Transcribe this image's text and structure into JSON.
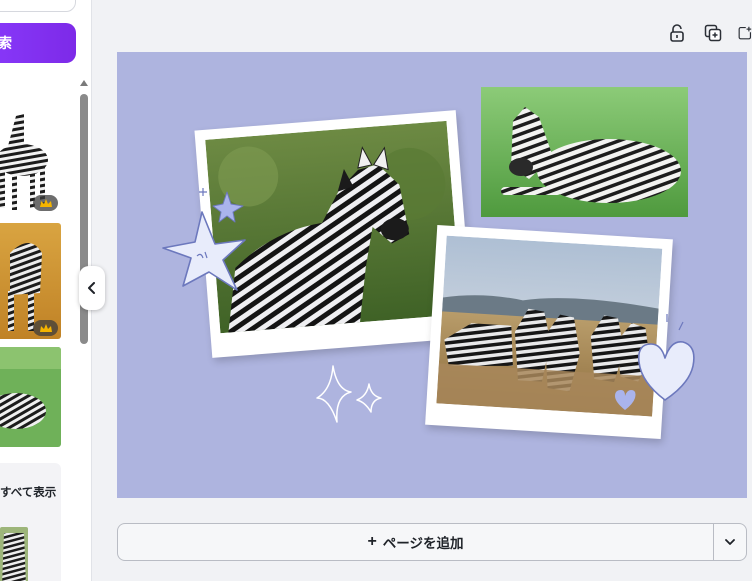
{
  "sidebar": {
    "search_button_label": "検索",
    "show_all_label": "すべて表示",
    "results": [
      {
        "name": "zebra-standing-cutout",
        "premium": true
      },
      {
        "name": "zebra-savanna",
        "premium": true
      },
      {
        "name": "zebra-lying",
        "premium": false
      }
    ]
  },
  "toolbar": {
    "icons": [
      "lock-icon",
      "duplicate-page-icon",
      "add-page-icon"
    ]
  },
  "canvas": {
    "background_color": "#aeb4df",
    "photos": [
      "zebra-closeup-photo",
      "zebra-lying-photo",
      "zebra-herd-photo"
    ],
    "decorations": [
      "star-doodle",
      "sparkle-doodle",
      "heart-doodle"
    ]
  },
  "footer": {
    "add_page_plus": "+",
    "add_page_label": "ページを追加"
  },
  "colors": {
    "accent": "#8b3dff",
    "canvas": "#aeb4df",
    "doodle_fill": "#e8ecfb",
    "doodle_stroke": "#6c78bd"
  }
}
